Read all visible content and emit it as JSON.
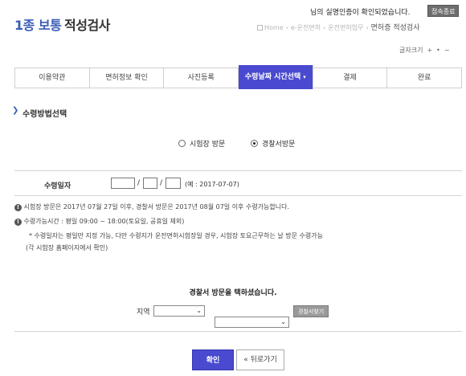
{
  "header": {
    "title_prefix": "1종 보통",
    "title_main": "적성검사",
    "auth_message": "님의 실명인증이 확인되었습니다.",
    "end_button": "접속종료",
    "breadcrumb": [
      "Home",
      "e-운전면허",
      "운전면허업무",
      "면허증 적성검사"
    ],
    "font_size_label": "글자크기",
    "font_size_plus": "+",
    "font_size_reset": "•",
    "font_size_minus": "−"
  },
  "steps": [
    {
      "label": "이용약관"
    },
    {
      "label": "면허정보 확인"
    },
    {
      "label": "사진등록"
    },
    {
      "label": "수령날짜 시간선택",
      "caret": "▾"
    },
    {
      "label": "결제"
    },
    {
      "label": "완료"
    }
  ],
  "active_step_index": 3,
  "section": {
    "arrow": "❯",
    "title": "수령방법선택"
  },
  "receive_method": {
    "options": [
      "시험장 방문",
      "경찰서방문"
    ],
    "selected": "경찰서방문"
  },
  "date_field": {
    "label": "수령일자",
    "year": "",
    "month": "",
    "day": "",
    "slash": "/",
    "example": "(예 : 2017-07-07)"
  },
  "notes": {
    "info1": "시험장 방문은 2017년 07월 27일 이후, 경찰서 방문은 2017년 08월 07일 이후 수령가능합니다.",
    "info2": "수령가능시간 : 평일 09:00 ~ 18:00(토요일, 공휴일 제외)",
    "info2_sub1": "* 수령일자는 평일만 지정 가능, 다만 수령지가 운전면허시험장일 경우, 시험장 토요근무하는 날 방문 수령가능",
    "info2_sub2": "(각 시험장 홈페이지에서 확인)"
  },
  "visit": {
    "title": "경찰서 방문을 택하셨습니다.",
    "region_label": "지역",
    "select1_value": "",
    "select2_value": "",
    "find_button": "경찰서찾기"
  },
  "buttons": {
    "confirm": "확인",
    "back": "« 뒤로가기"
  },
  "colors": {
    "accent": "#4a4ad0",
    "title_blue": "#3a5db5"
  }
}
